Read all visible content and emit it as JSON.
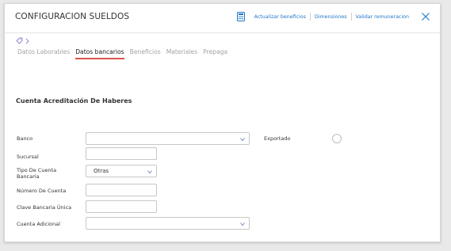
{
  "header": {
    "title": "CONFIGURACION SUELDOS",
    "actions": [
      "Actualizar beneficios",
      "Dimensiones",
      "Validar remuneracion"
    ]
  },
  "tabs": [
    "Datos Laborables",
    "Datos bancarios",
    "Beneficios",
    "Materiales",
    "Prepaga"
  ],
  "active_tab": "Datos bancarios",
  "section": {
    "title": "Cuenta Acreditación De Haberes"
  },
  "form": {
    "banco_label": "Banco",
    "banco_value": "",
    "exportado_label": "Exportado",
    "sucursal_label": "Sucursal",
    "sucursal_value": "",
    "tipo_cuenta_label": "Tipo De Cuenta Bancaria",
    "tipo_cuenta_value": "Otras",
    "numero_cuenta_label": "Número De Cuenta",
    "numero_cuenta_value": "",
    "clave_label": "Clave Bancaria Única",
    "clave_value": "",
    "cuenta_adicional_label": "Cuenta Adicional",
    "cuenta_adicional_value": ""
  },
  "colors": {
    "accent": "#1d76c7",
    "tab_underline": "#d9534f",
    "tag_icon": "#8b7fd6"
  },
  "icons": [
    "calculator-icon",
    "close-icon",
    "tag-icon",
    "chevron-right-icon",
    "chevron-down-icon"
  ]
}
